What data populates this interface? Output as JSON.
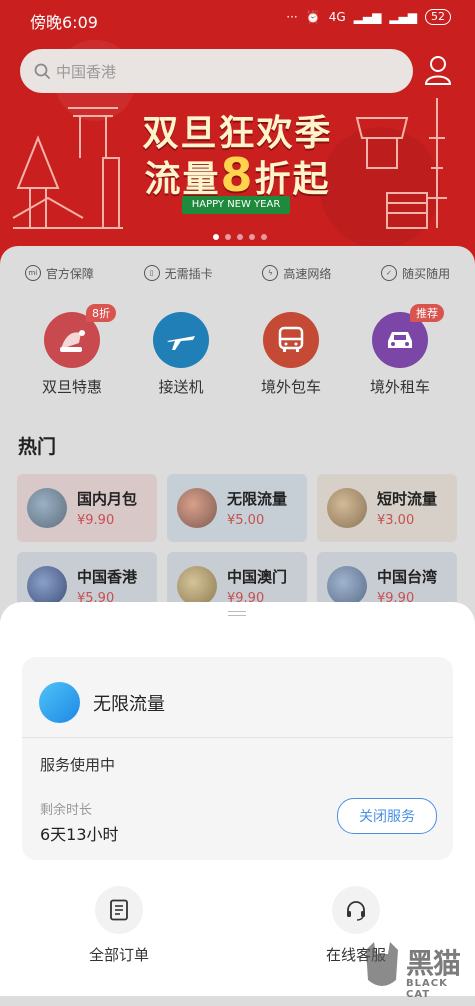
{
  "status_bar": {
    "time": "傍晚6:09",
    "network": "4G",
    "battery": "52"
  },
  "search": {
    "placeholder": "中国香港"
  },
  "banner": {
    "line1": "双旦狂欢季",
    "line2_prefix": "流量",
    "line2_number": "8",
    "line2_suffix": "折起",
    "tagline": "HAPPY NEW YEAR",
    "page_count": 5,
    "active_page": 1
  },
  "features": [
    {
      "label": "官方保障",
      "icon": "mi-icon"
    },
    {
      "label": "无需插卡",
      "icon": "sim-icon"
    },
    {
      "label": "高速网络",
      "icon": "bolt-icon"
    },
    {
      "label": "随买随用",
      "icon": "check-icon"
    }
  ],
  "categories": [
    {
      "label": "双旦特惠",
      "badge": "8折",
      "color": "#c84a4e",
      "icon": "santa-hat-icon"
    },
    {
      "label": "接送机",
      "badge": "",
      "color": "#1f7fb6",
      "icon": "airplane-icon"
    },
    {
      "label": "境外包车",
      "badge": "",
      "color": "#c44a35",
      "icon": "bus-icon"
    },
    {
      "label": "境外租车",
      "badge": "推荐",
      "color": "#7c46a6",
      "icon": "car-icon"
    }
  ],
  "hot": {
    "title": "热门",
    "items": [
      {
        "name": "国内月包",
        "price": "¥9.90",
        "bg": "#d9c8c8"
      },
      {
        "name": "无限流量",
        "price": "¥5.00",
        "bg": "#c7cfd6"
      },
      {
        "name": "短时流量",
        "price": "¥3.00",
        "bg": "#d6d0c8"
      },
      {
        "name": "中国香港",
        "price": "¥5.90",
        "bg": "#c8cdd4"
      },
      {
        "name": "中国澳门",
        "price": "¥9.90",
        "bg": "#c8cdd4"
      },
      {
        "name": "中国台湾",
        "price": "¥9.90",
        "bg": "#c8cdd4"
      }
    ]
  },
  "sheet": {
    "service_name": "无限流量",
    "status": "服务使用中",
    "remaining_label": "剩余时长",
    "remaining_value": "6天13小时",
    "close_button": "关闭服务",
    "actions": [
      {
        "label": "全部订单",
        "icon": "orders-icon"
      },
      {
        "label": "在线客服",
        "icon": "headset-icon"
      }
    ]
  },
  "watermark": {
    "cn": "黑猫",
    "en": "BLACK CAT"
  },
  "colors": {
    "banner_red": "#c9201f",
    "accent_blue": "#4a90e2",
    "price_red": "#c65050"
  }
}
